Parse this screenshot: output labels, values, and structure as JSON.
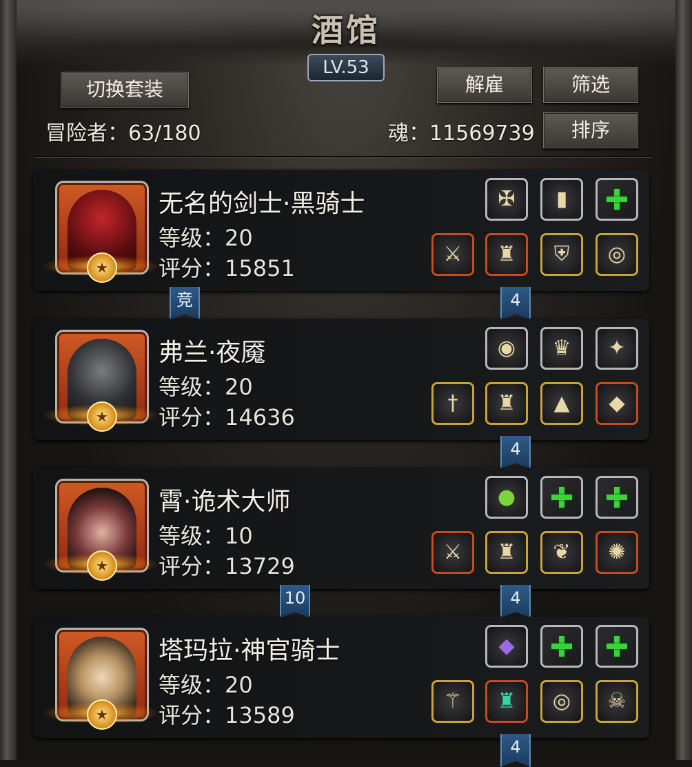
{
  "header": {
    "title": "酒馆",
    "level": "LV.53",
    "switch_button": "切换套装",
    "dismiss_button": "解雇",
    "filter_button": "筛选",
    "sort_button": "排序",
    "adventurers": "冒险者：63/180",
    "soul": "魂：11569739"
  },
  "heroes": [
    {
      "name": "无名的剑士·黑骑士",
      "level": "等级：20",
      "score": "评分：15851",
      "left_ribbon": "竞",
      "right_ribbon": "4",
      "top_slots": [
        "amulet-icon",
        "book-icon",
        "empty"
      ],
      "bottom_slots": [
        "sword-icon",
        "armor-icon",
        "shield-icon",
        "ring-icon"
      ]
    },
    {
      "name": "弗兰·夜魇",
      "level": "等级：20",
      "score": "评分：14636",
      "left_ribbon": "",
      "right_ribbon": "4",
      "top_slots": [
        "orb-icon",
        "emblem-icon",
        "crest-icon"
      ],
      "bottom_slots": [
        "dagger-icon",
        "armor-icon",
        "cloak-icon",
        "gem-icon"
      ]
    },
    {
      "name": "霄·诡术大师",
      "level": "等级：10",
      "score": "评分：13729",
      "left_ribbon": "10",
      "right_ribbon": "4",
      "top_slots": [
        "charm-icon",
        "empty",
        "empty"
      ],
      "bottom_slots": [
        "sword-icon",
        "armor-icon",
        "necklace-icon",
        "relic-icon"
      ]
    },
    {
      "name": "塔玛拉·神官骑士",
      "level": "等级：20",
      "score": "评分：13589",
      "left_ribbon": "",
      "right_ribbon": "4",
      "top_slots": [
        "crystal-icon",
        "empty",
        "empty"
      ],
      "bottom_slots": [
        "staff-icon",
        "robe-icon",
        "bracelet-icon",
        "mask-icon"
      ]
    }
  ]
}
